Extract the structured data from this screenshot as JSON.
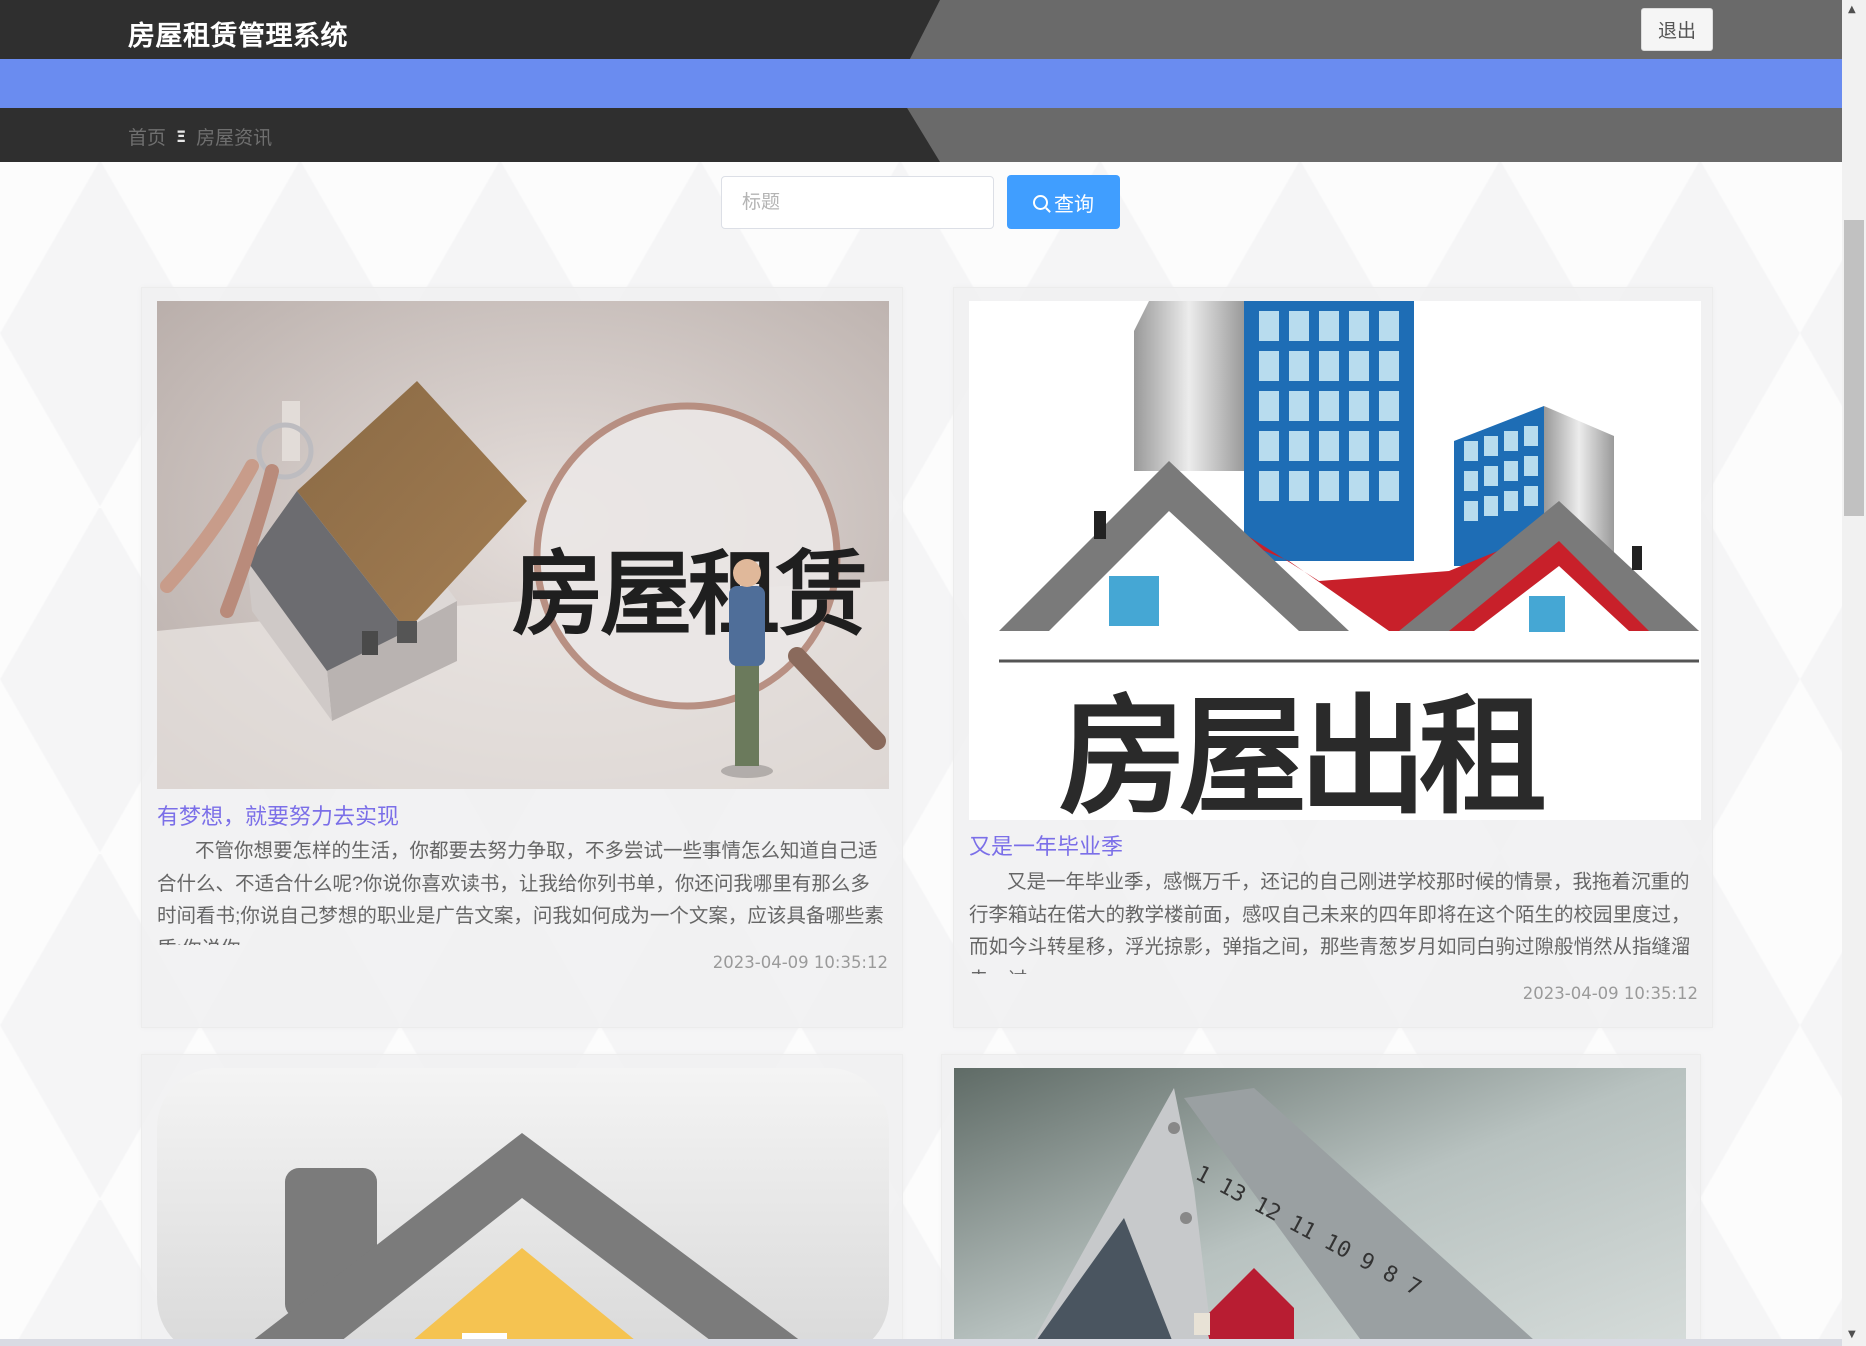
{
  "header": {
    "app_title": "房屋租赁管理系统",
    "logout_label": "退出"
  },
  "breadcrumb": {
    "home": "首页",
    "separator": "Ξ",
    "current": "房屋资讯"
  },
  "search": {
    "placeholder": "标题",
    "button_label": "查询"
  },
  "articles": [
    {
      "title": "有梦想，就要努力去实现",
      "summary": "不管你想要怎样的生活，你都要去努力争取，不多尝试一些事情怎么知道自己适合什么、不适合什么呢?你说你喜欢读书，让我给你列书单，你还问我哪里有那么多时间看书;你说自己梦想的职业是广告文案，问我如何成为一个文案，应该具备哪些素质;你说你",
      "date": "2023-04-09 10:35:12",
      "image_text": "房屋租赁"
    },
    {
      "title": "又是一年毕业季",
      "summary": "又是一年毕业季，感慨万千，还记的自己刚进学校那时候的情景，我拖着沉重的行李箱站在偌大的教学楼前面，感叹自己未来的四年即将在这个陌生的校园里度过，而如今斗转星移，浮光掠影，弹指之间，那些青葱岁月如同白驹过隙般悄然从指缝溜走。过",
      "date": "2023-04-09 10:35:12",
      "image_text": "房屋出租"
    },
    {
      "title": "",
      "summary": "",
      "date": ""
    },
    {
      "title": "",
      "summary": "",
      "date": "",
      "image_text": "1 13 12 11 10 9 8 7"
    }
  ],
  "colors": {
    "header_dark": "#2f2f2f",
    "header_gray": "#6a6a6a",
    "accent_band": "#6a8cf0",
    "primary_button": "#409eff",
    "link_title": "#7b6fe8"
  }
}
